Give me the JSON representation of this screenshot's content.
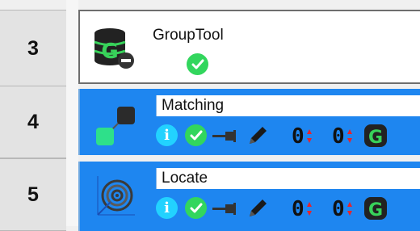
{
  "rows": [
    {
      "number": "3",
      "title": "GroupTool",
      "state": "plain"
    },
    {
      "number": "4",
      "title": "Matching",
      "state": "selected",
      "count_a": "0",
      "count_b": "0"
    },
    {
      "number": "5",
      "title": "Locate",
      "state": "selected",
      "count_a": "0",
      "count_b": "0"
    }
  ],
  "icons": {
    "group_tool": "database-g-minus-icon",
    "check": "check-circle-icon",
    "info": "info-circle-icon",
    "pin": "pin-icon",
    "pencil": "pencil-icon",
    "matching": "matching-nodes-icon",
    "locate": "target-icon",
    "g_logo": "g-logo-icon"
  },
  "colors": {
    "selected_bg": "#1e86f0",
    "check_green": "#32d65d",
    "info_cyan": "#22d2ff",
    "spinner_red": "#e8232a",
    "g_green": "#38d25a"
  }
}
